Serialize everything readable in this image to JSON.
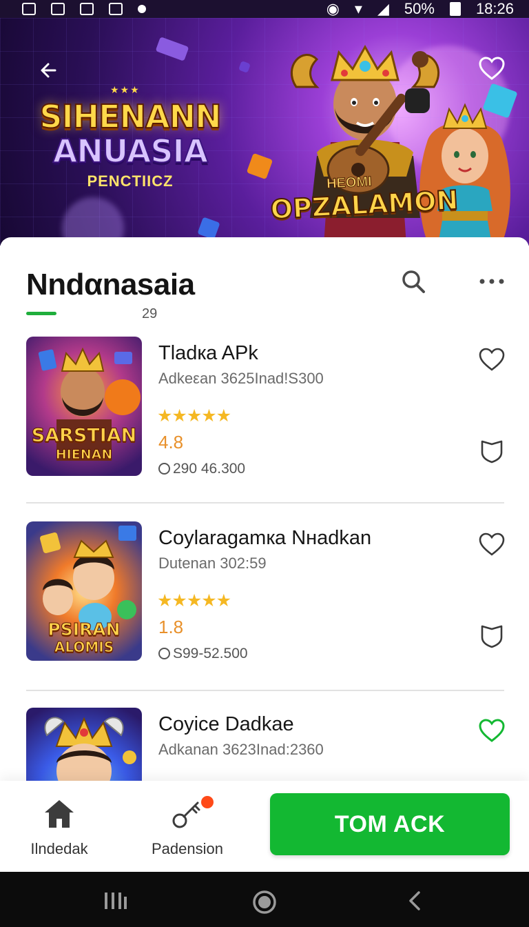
{
  "status_bar": {
    "battery": "50%",
    "time": "18:26"
  },
  "hero": {
    "title_line1": "SIHENANN",
    "title_line2": "ANUASIA",
    "title_line3": "PENCTIICZ",
    "badge_line1": "HEOMI",
    "badge_line2": "OPZALAMON"
  },
  "header": {
    "title": "Nndαnasaia",
    "count": "29"
  },
  "items": [
    {
      "name": "Tladкa APk",
      "subtitle": "Adkeεan 3625Inad!S300",
      "stars": "★★★★★",
      "rating": "4.8",
      "downloads": "290 46.300",
      "thumb_line1": "SARSTIAN",
      "thumb_line2": "HIENAN",
      "favorited": false
    },
    {
      "name": "Coylaragamкa Nнadkan",
      "subtitle": "Dutenan 302:59",
      "stars": "★★★★★",
      "rating": "1.8",
      "downloads": "S99-52.500",
      "thumb_line1": "PSIRAN",
      "thumb_line2": "ALOMIS",
      "favorited": false
    },
    {
      "name": "Coyice Dadkae",
      "subtitle": "Adkanan 3623Inad:2360",
      "favorited": true
    }
  ],
  "bottom_nav": {
    "tabs": [
      {
        "label": "Ilndedak",
        "icon": "home-icon"
      },
      {
        "label": "Padension",
        "icon": "key-icon"
      }
    ],
    "cta_label": "TOM ACK"
  },
  "colors": {
    "accent_green": "#13b832",
    "star_yellow": "#f5b823",
    "rating_orange": "#e8902a"
  }
}
